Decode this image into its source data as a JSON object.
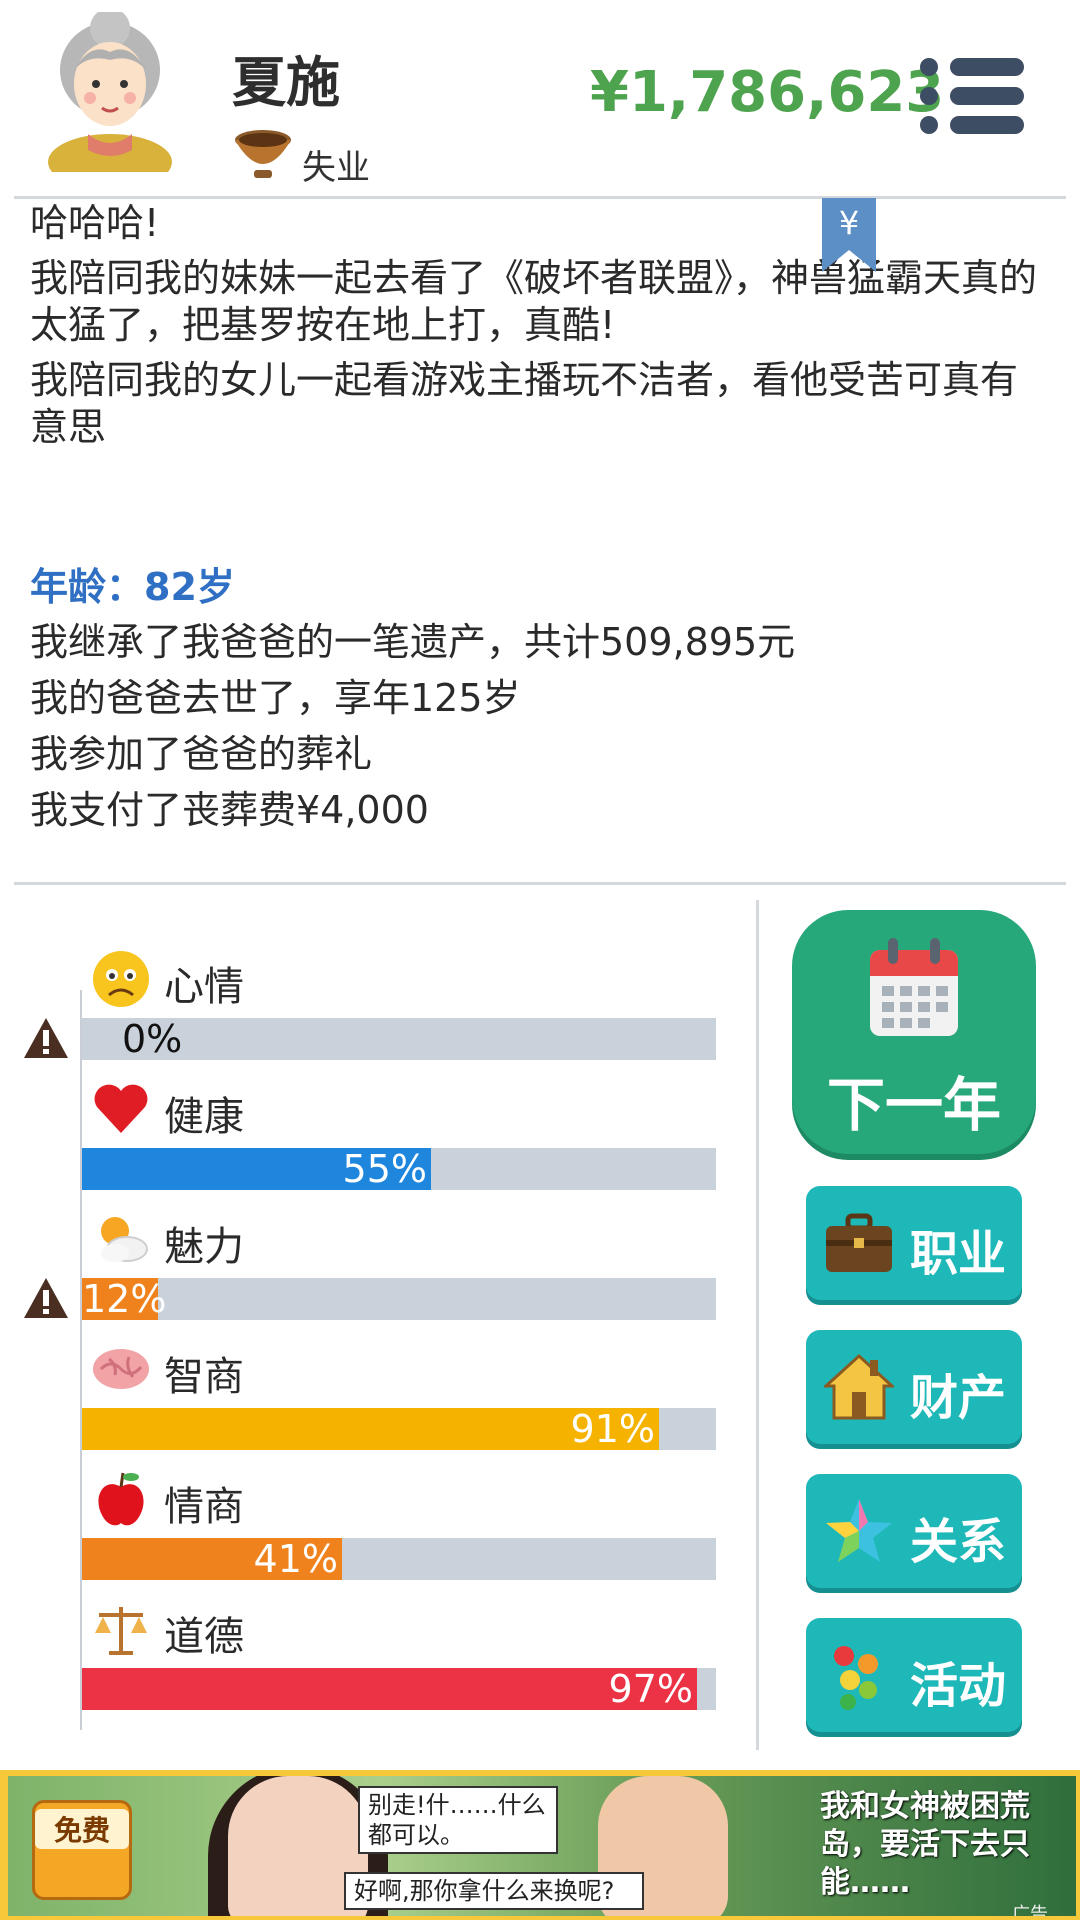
{
  "header": {
    "name": "夏施",
    "job": "失业",
    "money": "¥1,786,623",
    "icons": {
      "avatar": "elderly-woman-avatar",
      "job": "begging-bowl-icon",
      "menu": "menu-icon"
    }
  },
  "log": {
    "lines": [
      "哈哈哈!",
      "我陪同我的妹妹一起去看了《破坏者联盟》，神兽猛霸天真的太猛了，把基罗按在地上打，真酷!",
      "我陪同我的女儿一起看游戏主播玩不洁者，看他受苦可真有意思"
    ],
    "ribbon": "¥",
    "age": "年龄：82岁",
    "events": [
      "我继承了我爸爸的一笔遗产，共计509,895元",
      "我的爸爸去世了，享年125岁",
      "我参加了爸爸的葬礼",
      "我支付了丧葬费¥4,000"
    ]
  },
  "stats": [
    {
      "label": "心情",
      "value": 0,
      "text": "0%",
      "color": "#c9d1db",
      "icon": "sad-face-icon",
      "warning": true
    },
    {
      "label": "健康",
      "value": 55,
      "text": "55%",
      "color": "#1f86de",
      "icon": "heart-icon",
      "warning": false
    },
    {
      "label": "魅力",
      "value": 12,
      "text": "12%",
      "color": "#f0821e",
      "icon": "sun-cloud-icon",
      "warning": true
    },
    {
      "label": "智商",
      "value": 91,
      "text": "91%",
      "color": "#f5b300",
      "icon": "brain-icon",
      "warning": false
    },
    {
      "label": "情商",
      "value": 41,
      "text": "41%",
      "color": "#f0821e",
      "icon": "apple-icon",
      "warning": false
    },
    {
      "label": "道德",
      "value": 97,
      "text": "97%",
      "color": "#ec3345",
      "icon": "scales-icon",
      "warning": false
    }
  ],
  "buttons": {
    "next_year": "下一年",
    "career": "职业",
    "assets": "财产",
    "relations": "关系",
    "activities": "活动"
  },
  "ad": {
    "badge": "免费",
    "bubble1": "别走!什……什么都可以。",
    "bubble2": "好啊,那你拿什么来换呢?",
    "text": "我和女神被困荒岛，要活下去只能……",
    "mark": "广告"
  }
}
